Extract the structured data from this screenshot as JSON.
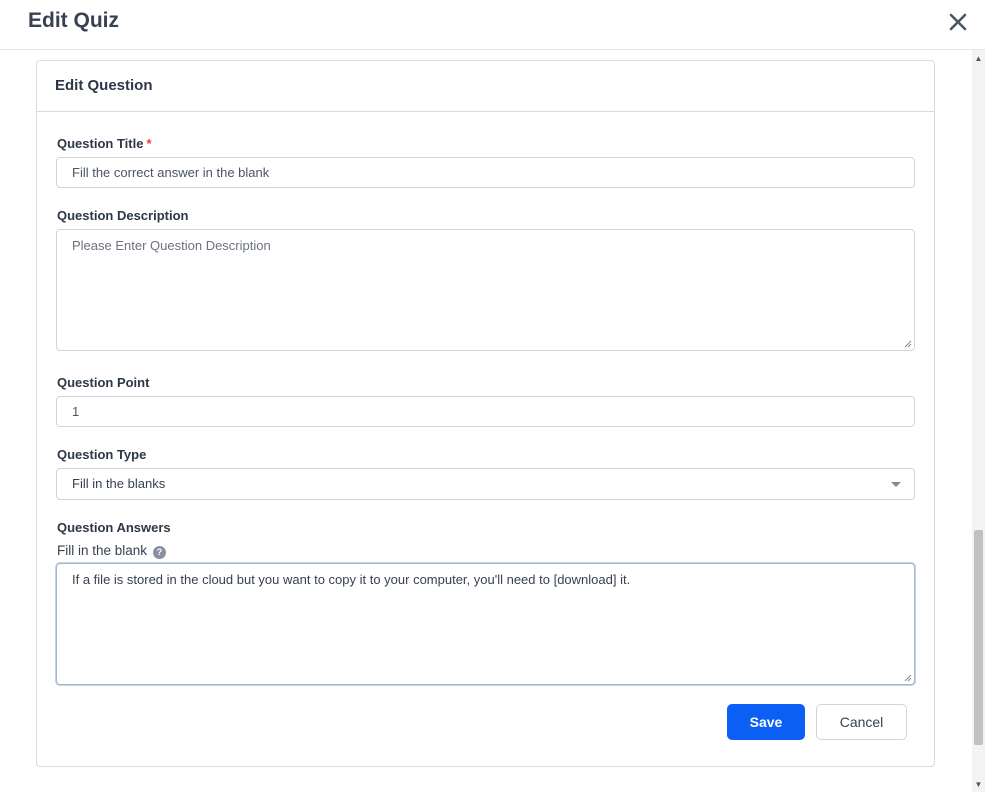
{
  "modal": {
    "title": "Edit Quiz"
  },
  "card": {
    "title": "Edit Question"
  },
  "fields": {
    "title_label": "Question Title",
    "title_required": "*",
    "title_value": "Fill the correct answer in the blank",
    "description_label": "Question Description",
    "description_placeholder": "Please Enter Question Description",
    "point_label": "Question Point",
    "point_value": "1",
    "type_label": "Question Type",
    "type_selected": "Fill in the blanks",
    "answers_label": "Question Answers",
    "fill_blank_label": "Fill in the blank",
    "help_icon_glyph": "?",
    "fill_blank_value": "If a file is stored in the cloud but you want to copy it to your computer, you'll need to [download] it."
  },
  "actions": {
    "save_label": "Save",
    "cancel_label": "Cancel"
  },
  "icons": {
    "close": "close-icon",
    "help": "help-icon",
    "dropdown": "chevron-down-icon"
  },
  "colors": {
    "primary": "#0b5ff5",
    "required": "#e53e3e",
    "border": "#d1d5db"
  }
}
